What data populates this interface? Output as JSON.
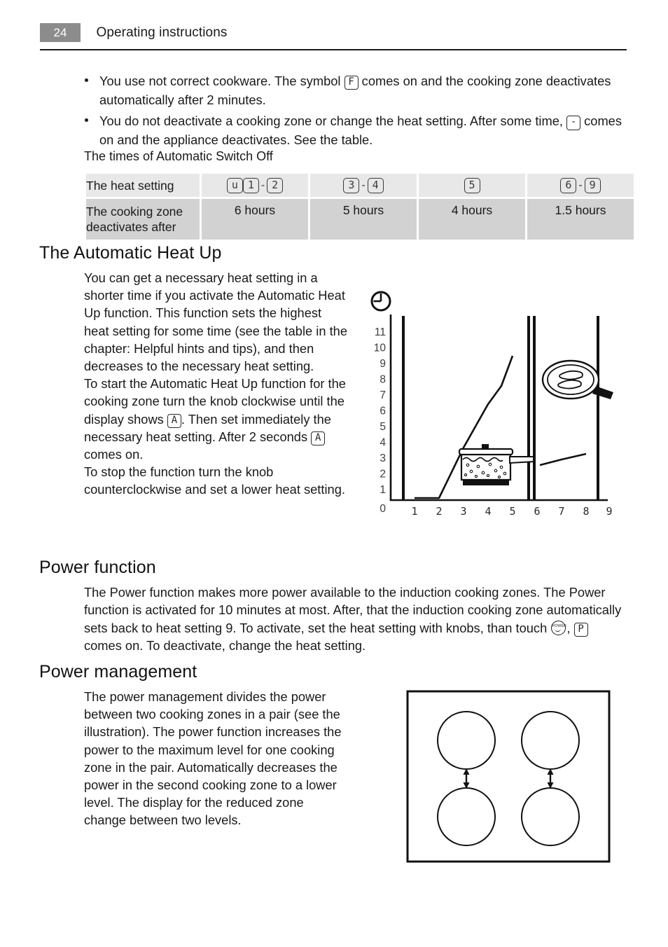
{
  "header": {
    "page_number": "24",
    "title": "Operating instructions"
  },
  "bullets": [
    {
      "text_before": "You use not correct cookware. The symbol",
      "symbol": "F",
      "text_after": "comes on and the cooking zone deactivates automatically after 2 minutes."
    },
    {
      "text_before": "You do not deactivate a cooking zone or change the heat setting. After some time,",
      "symbol": "-",
      "text_after": "comes on and the appliance deactivates. See the table."
    }
  ],
  "table_caption": "The times of Automatic Switch Off",
  "table": {
    "row_labels": [
      "The heat setting",
      "The cooking zone deactivates after"
    ],
    "columns": [
      {
        "heat_setting_symbols": [
          "u",
          "1",
          "2"
        ],
        "separator_after_index": 1,
        "deactivates_after": "6 hours"
      },
      {
        "heat_setting_symbols": [
          "3",
          "4"
        ],
        "separator_after_index": 0,
        "deactivates_after": "5 hours"
      },
      {
        "heat_setting_symbols": [
          "5"
        ],
        "separator_after_index": -1,
        "deactivates_after": "4 hours"
      },
      {
        "heat_setting_symbols": [
          "6",
          "9"
        ],
        "separator_after_index": 0,
        "deactivates_after": "1.5 hours"
      }
    ],
    "separator": "-"
  },
  "sections": {
    "automatic_heat_up": {
      "heading": "The Automatic Heat Up",
      "paragraph_1": "You can get a necessary heat setting in a shorter time if you activate the Automatic Heat Up function. This function sets the highest heat setting for some time (see the table in the chapter: Helpful hints and tips), and then decreases to the necessary heat setting.",
      "paragraph_2_before": "To start the Automatic Heat Up function for the cooking zone turn the knob clockwise until the display shows",
      "paragraph_2_symbol_1": "A",
      "paragraph_2_middle": ". Then set immediately the necessary heat setting. After 2 seconds",
      "paragraph_2_symbol_2": "A",
      "paragraph_2_after": "comes on.",
      "paragraph_3": "To stop the function turn the knob counterclockwise and set a lower heat setting."
    },
    "power_function": {
      "heading": "Power function",
      "text_before_icon": "The Power function makes more power available to the induction cooking zones. The Power function is activated for 10 minutes at most. After, that the induction cooking zone automatically sets back to heat setting 9. To activate, set the heat setting with knobs, than touch",
      "icon_label": "POWER",
      "separator": ",",
      "symbol": "P",
      "text_after_symbol": "comes on. To deactivate, change the heat setting."
    },
    "power_management": {
      "heading": "Power management",
      "paragraph": "The power management divides the power between two cooking zones in a pair (see the illustration). The power function increases the power to the maximum level for one cooking zone in the pair. Automatically decreases the power in the second cooking zone to a lower level. The display for the reduced zone change between two levels."
    }
  },
  "chart_data": {
    "type": "line",
    "title": "",
    "xlabel": "",
    "ylabel": "",
    "y_axis_icon": "clock-icon",
    "ylim": [
      0,
      12
    ],
    "xlim": [
      0,
      9.5
    ],
    "y_ticks": [
      0,
      1,
      2,
      3,
      4,
      5,
      6,
      7,
      8,
      9,
      10,
      11
    ],
    "x_ticks": [
      1,
      2,
      3,
      4,
      5,
      6,
      7,
      8,
      9
    ],
    "grid": false,
    "legend": "none",
    "vertical_markers": [
      0.55,
      5.6,
      5.82,
      8.42
    ],
    "series": [
      {
        "name": "Automatic Heat Up curve",
        "x": [
          0.95,
          2.0,
          3.0,
          4.0,
          4.45,
          5.05
        ],
        "y": [
          0.18,
          0.18,
          3.3,
          6.1,
          7.3,
          10.2
        ]
      },
      {
        "name": "Normal heating curve",
        "x": [
          5.95,
          7.0,
          8.05
        ],
        "y": [
          2.25,
          2.62,
          2.98
        ]
      }
    ],
    "annotations": [
      {
        "name": "saucepan-icon",
        "x": 4.0,
        "y": 1.9
      },
      {
        "name": "frying-pan-icon",
        "x": 7.3,
        "y": 8.3
      }
    ]
  },
  "hob_illustration": {
    "name": "hob-four-zones",
    "zones": 4,
    "pair_arrows": 2,
    "arrow_direction": "double-vertical"
  }
}
